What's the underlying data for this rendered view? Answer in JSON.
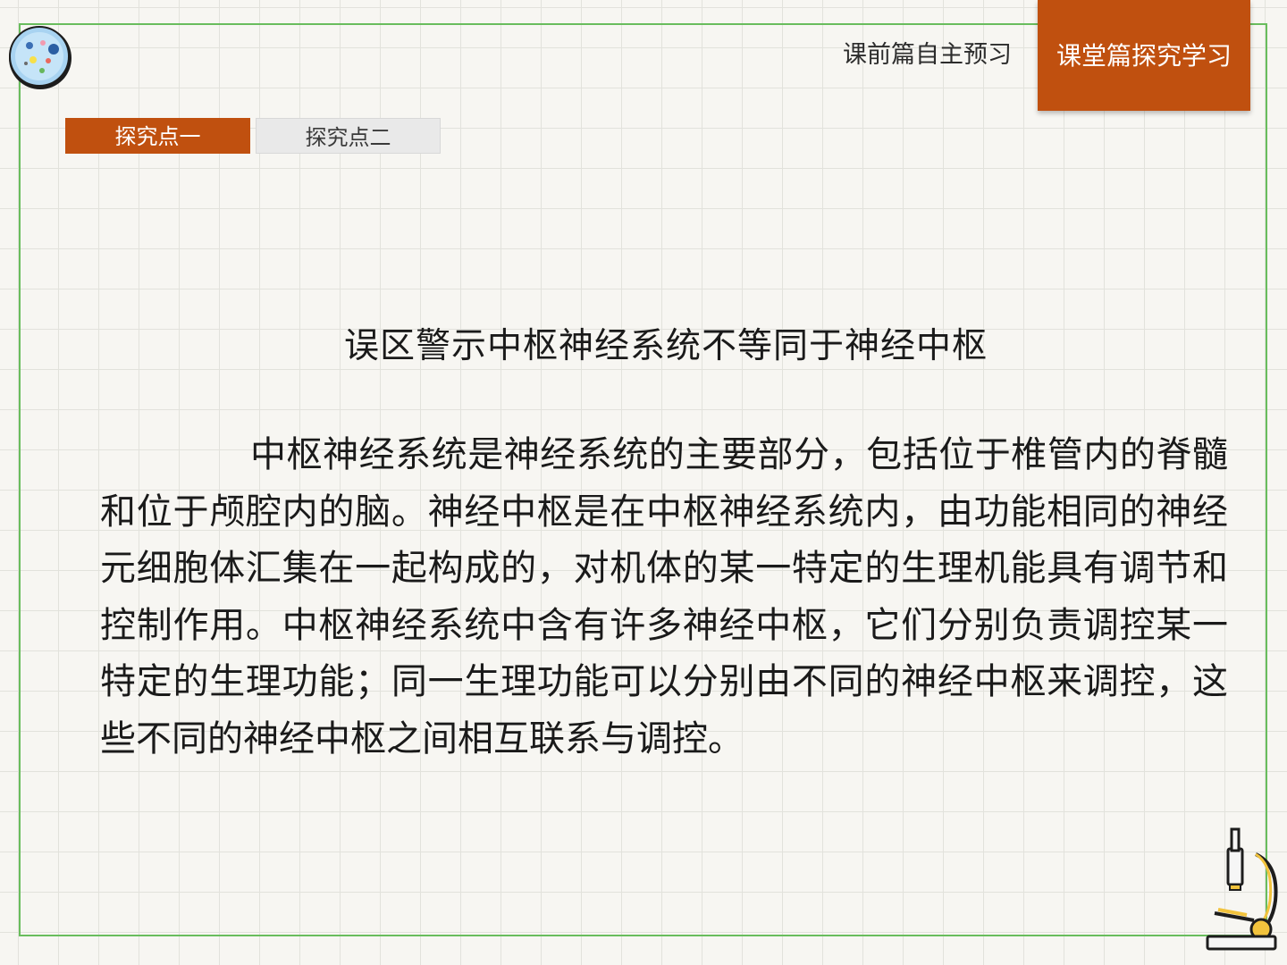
{
  "nav": {
    "prev_label": "课前篇自主预习",
    "active_label": "课堂篇探究学习"
  },
  "tabs": [
    {
      "label": "探究点一",
      "active": true
    },
    {
      "label": "探究点二",
      "active": false
    }
  ],
  "content": {
    "heading": "误区警示中枢神经系统不等同于神经中枢",
    "paragraph": "中枢神经系统是神经系统的主要部分，包括位于椎管内的脊髓和位于颅腔内的脑。神经中枢是在中枢神经系统内，由功能相同的神经元细胞体汇集在一起构成的，对机体的某一特定的生理机能具有调节和控制作用。中枢神经系统中含有许多神经中枢，它们分别负责调控某一特定的生理功能；同一生理功能可以分别由不同的神经中枢来调控，这些不同的神经中枢之间相互联系与调控。"
  },
  "colors": {
    "accent": "#c0500f",
    "frame": "#69bd5d",
    "tab_inactive": "#e9e9e9"
  },
  "icons": {
    "logo": "petri-dish-icon",
    "corner": "microscope-icon"
  }
}
